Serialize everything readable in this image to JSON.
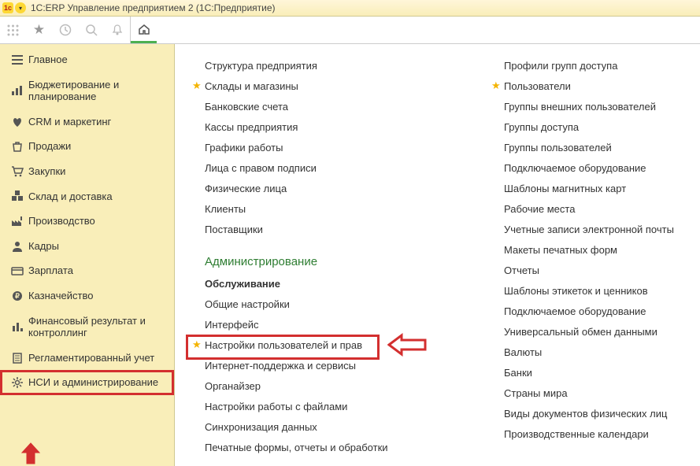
{
  "window": {
    "title": "1С:ERP Управление предприятием 2  (1С:Предприятие)"
  },
  "sidebar": {
    "items": [
      {
        "icon": "menu",
        "label": "Главное"
      },
      {
        "icon": "bars",
        "label": "Бюджетирование и планирование"
      },
      {
        "icon": "heart",
        "label": "CRM и маркетинг"
      },
      {
        "icon": "bag",
        "label": "Продажи"
      },
      {
        "icon": "cart",
        "label": "Закупки"
      },
      {
        "icon": "boxes",
        "label": "Склад и доставка"
      },
      {
        "icon": "factory",
        "label": "Производство"
      },
      {
        "icon": "person",
        "label": "Кадры"
      },
      {
        "icon": "card",
        "label": "Зарплата"
      },
      {
        "icon": "ruble",
        "label": "Казначейство"
      },
      {
        "icon": "chart",
        "label": "Финансовый результат и контроллинг"
      },
      {
        "icon": "doc",
        "label": "Регламентированный учет"
      },
      {
        "icon": "gear",
        "label": "НСИ и администрирование"
      }
    ]
  },
  "content": {
    "col1_top": [
      {
        "star": false,
        "label": "Структура предприятия"
      },
      {
        "star": true,
        "label": "Склады и магазины"
      },
      {
        "star": false,
        "label": "Банковские счета"
      },
      {
        "star": false,
        "label": "Кассы предприятия"
      },
      {
        "star": false,
        "label": "Графики работы"
      },
      {
        "star": false,
        "label": "Лица с правом подписи"
      },
      {
        "star": false,
        "label": "Физические лица"
      },
      {
        "star": false,
        "label": "Клиенты"
      },
      {
        "star": false,
        "label": "Поставщики"
      }
    ],
    "section": "Администрирование",
    "col1_admin": [
      {
        "star": false,
        "bold": true,
        "label": "Обслуживание"
      },
      {
        "star": false,
        "label": "Общие настройки"
      },
      {
        "star": false,
        "label": "Интерфейс"
      },
      {
        "star": true,
        "label": "Настройки пользователей и прав"
      },
      {
        "star": false,
        "label": "Интернет-поддержка и сервисы"
      },
      {
        "star": false,
        "label": "Органайзер"
      },
      {
        "star": false,
        "label": "Настройки работы с файлами"
      },
      {
        "star": false,
        "label": "Синхронизация данных"
      },
      {
        "star": false,
        "label": "Печатные формы, отчеты и обработки"
      }
    ],
    "col2": [
      {
        "star": false,
        "label": "Профили групп доступа"
      },
      {
        "star": true,
        "label": "Пользователи"
      },
      {
        "star": false,
        "label": "Группы внешних пользователей"
      },
      {
        "star": false,
        "label": "Группы доступа"
      },
      {
        "star": false,
        "label": "Группы пользователей"
      },
      {
        "star": false,
        "label": "Подключаемое оборудование"
      },
      {
        "star": false,
        "label": "Шаблоны магнитных карт"
      },
      {
        "star": false,
        "label": "Рабочие места"
      },
      {
        "star": false,
        "label": "Учетные записи электронной почты"
      },
      {
        "star": false,
        "label": "Макеты печатных форм"
      },
      {
        "star": false,
        "label": "Отчеты"
      },
      {
        "star": false,
        "label": "Шаблоны этикеток и ценников"
      },
      {
        "star": false,
        "label": "Подключаемое оборудование"
      },
      {
        "star": false,
        "label": "Универсальный обмен данными"
      },
      {
        "star": false,
        "label": "Валюты"
      },
      {
        "star": false,
        "label": "Банки"
      },
      {
        "star": false,
        "label": "Страны мира"
      },
      {
        "star": false,
        "label": "Виды документов физических лиц"
      },
      {
        "star": false,
        "label": "Производственные календари"
      }
    ]
  }
}
